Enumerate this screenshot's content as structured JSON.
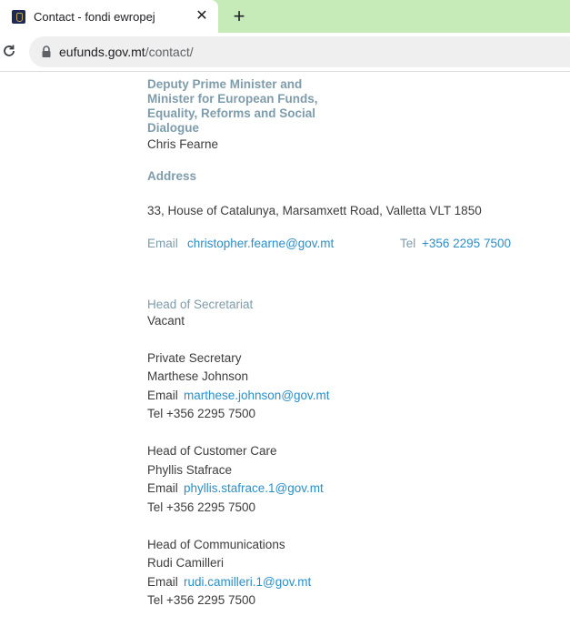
{
  "browser": {
    "tab_title": "Contact - fondi ewropej",
    "tab_close": "✕",
    "new_tab": "+",
    "url_host": "eufunds.gov.mt",
    "url_path": "/contact/"
  },
  "minister": {
    "title": "Deputy Prime Minister and Minister for European Funds, Equality, Reforms and Social Dialogue",
    "name": "Chris Fearne"
  },
  "address": {
    "heading": "Address",
    "value": "33, House of Catalunya, Marsamxett Road, Valletta VLT 1850"
  },
  "contact_main": {
    "email_label": "Email",
    "email": "christopher.fearne@gov.mt",
    "tel_label": "Tel",
    "tel": "+356 2295 7500"
  },
  "secretariat": {
    "heading": "Head of Secretariat",
    "name": "Vacant"
  },
  "staff": [
    {
      "role": "Private Secretary",
      "name": "Marthese Johnson",
      "email_label": "Email",
      "email": "marthese.johnson@gov.mt",
      "tel_line": "Tel +356 2295 7500"
    },
    {
      "role": "Head of Customer Care",
      "name": "Phyllis Stafrace",
      "email_label": "Email",
      "email": "phyllis.stafrace.1@gov.mt",
      "tel_line": "Tel +356 2295 7500"
    },
    {
      "role": "Head of Communications",
      "name": "Rudi Camilleri",
      "email_label": "Email",
      "email": "rudi.camilleri.1@gov.mt",
      "tel_line": "Tel +356 2295 7500"
    }
  ]
}
